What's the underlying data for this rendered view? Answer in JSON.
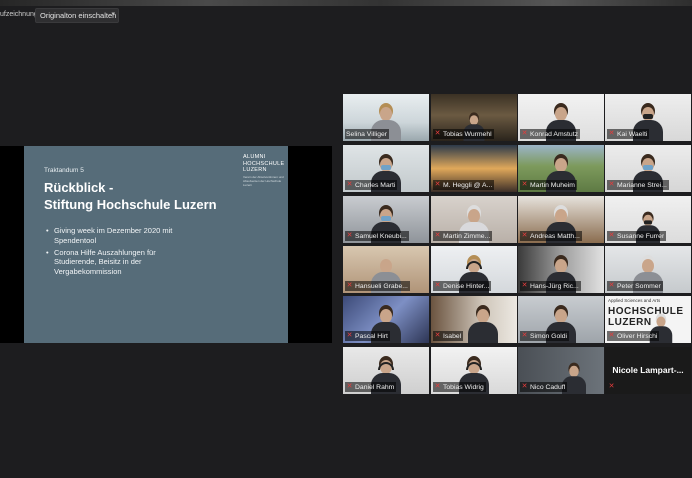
{
  "toolbar": {
    "recording_label": "ufzeichnung",
    "audio_select": {
      "selected": "Originalton einschalten"
    }
  },
  "slide": {
    "kicker": "Traktandum 5",
    "title_line1": "Rückblick -",
    "title_line2": "Stiftung Hochschule Luzern",
    "logo_lines": [
      "ALUMNI",
      "HOCHSCHULE",
      "LUZERN"
    ],
    "logo_sub": "Verein der Absolventinnen und Absolventen der Hochschule Luzern",
    "bullets": [
      "Giving week im Dezember 2020 mit Spendentool",
      "Corona Hilfe Auszahlungen für Studierende, Beisitz in der Vergabekommission"
    ]
  },
  "participants": [
    {
      "name": "Selina Villiger",
      "mic": "on"
    },
    {
      "name": "Tobias Wurmehl",
      "mic": "muted"
    },
    {
      "name": "Konrad Amstutz",
      "mic": "muted"
    },
    {
      "name": "Kai Waelti",
      "mic": "muted"
    },
    {
      "name": "Charles Marti",
      "mic": "muted"
    },
    {
      "name": "M. Heggli @ A...",
      "mic": "muted"
    },
    {
      "name": "Martin Muheim",
      "mic": "muted"
    },
    {
      "name": "Marianne Strei...",
      "mic": "muted"
    },
    {
      "name": "Samuel Kneubi...",
      "mic": "muted"
    },
    {
      "name": "Martin Zimme...",
      "mic": "muted"
    },
    {
      "name": "Andreas Matth...",
      "mic": "muted"
    },
    {
      "name": "Susanne Furrer",
      "mic": "muted"
    },
    {
      "name": "Hansueli Grabe...",
      "mic": "muted"
    },
    {
      "name": "Denise Hinter...",
      "mic": "muted"
    },
    {
      "name": "Hans-Jürg Ric...",
      "mic": "muted"
    },
    {
      "name": "Peter Sommer",
      "mic": "muted"
    },
    {
      "name": "Pascal Hirt",
      "mic": "muted"
    },
    {
      "name": "Isabel",
      "mic": "muted"
    },
    {
      "name": "Simon Goldi",
      "mic": "muted"
    },
    {
      "name": "Oliver Hirschi",
      "mic": "muted"
    },
    {
      "name": "Daniel Rahm",
      "mic": "muted"
    },
    {
      "name": "Tobias Widrig",
      "mic": "muted"
    },
    {
      "name": "Nico Caduff",
      "mic": "muted"
    },
    {
      "name": "Nicole Lampart-...",
      "mic": "muted"
    }
  ],
  "tile_overlays": {
    "hochschule_header": "Applied Sciences and Arts",
    "hochschule_logo": "HOCHSCHULE LUZERN"
  },
  "colors": {
    "background": "#1d1d1f",
    "slide_background": "#566c79",
    "active_speaker_border": "#d7e46a",
    "muted_mic": "#e43c3c"
  }
}
